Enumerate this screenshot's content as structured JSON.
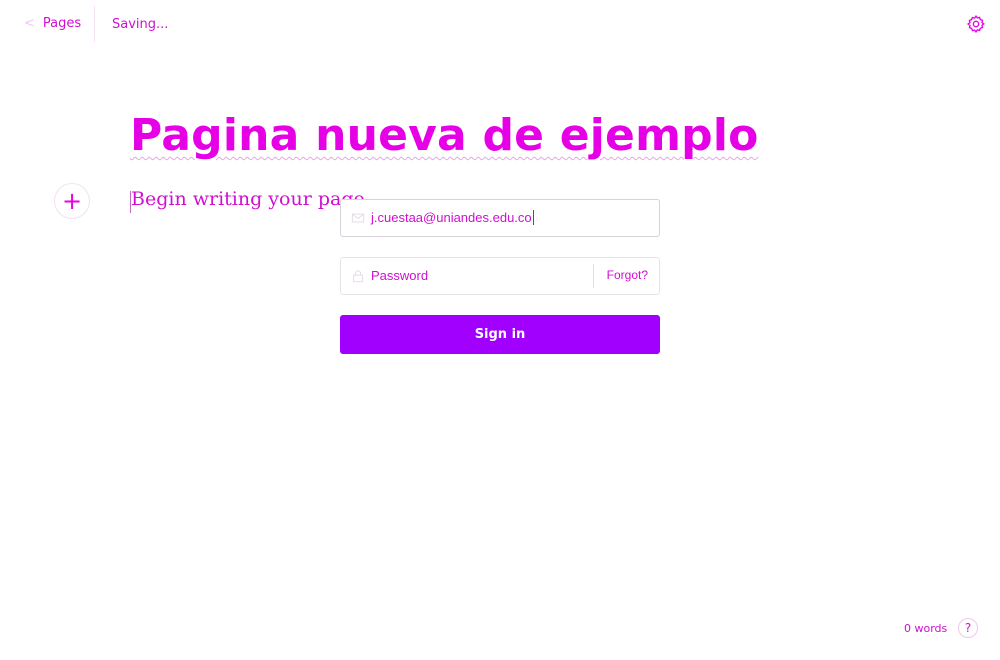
{
  "topbar": {
    "back_label": "Pages",
    "status": "Saving..."
  },
  "editor": {
    "title": "Pagina nueva de ejemplo",
    "body_placeholder": "Begin writing your page..."
  },
  "signin_form": {
    "email_value": "j.cuestaa@uniandes.edu.co",
    "password_placeholder": "Password",
    "forgot_label": "Forgot?",
    "submit_label": "Sign in"
  },
  "footer": {
    "word_count": "0 words",
    "help_label": "?"
  },
  "colors": {
    "accent": "#e600e6",
    "button": "#a100ff"
  },
  "icons": [
    "chevron-left-icon",
    "gear-icon",
    "plus-icon",
    "mail-icon",
    "lock-icon",
    "help-icon"
  ]
}
